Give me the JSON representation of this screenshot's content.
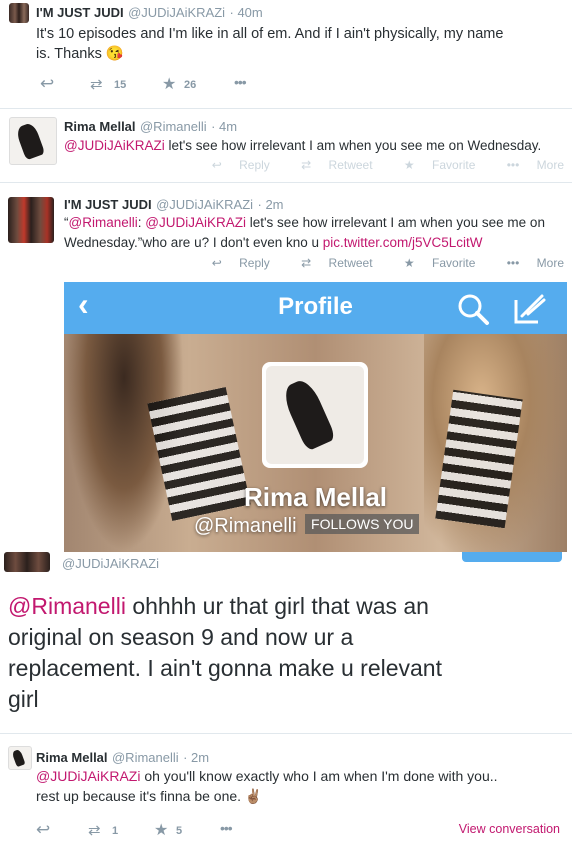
{
  "tweet1": {
    "name": "I'M JUST JUDI",
    "handle": "@JUDiJAiKRAZi",
    "time": "· 40m",
    "text_line1": "It's 10 episodes and I'm like in all of em. And if I ain't physically, my name",
    "text_line2": "is. Thanks",
    "emoji": "😘",
    "retweets": "15",
    "favorites": "26"
  },
  "tweet2": {
    "name": "Rima Mellal",
    "handle": "@Rimanelli",
    "time": "· 4m",
    "mention": "@JUDiJAiKRAZi",
    "text": " let's see how irrelevant I am when you see me on Wednesday.",
    "reply": "Reply",
    "retweet": "Retweet",
    "favorite": "Favorite",
    "more": "More"
  },
  "tweet3": {
    "name": "I'M JUST JUDI",
    "handle": "@JUDiJAiKRAZi",
    "time": "· 2m",
    "quote_open": "“",
    "mention1": "@Rimanelli",
    "colon": ": ",
    "mention2": "@JUDiJAiKRAZi",
    "text_line1_rest": " let's see how irrelevant I am when you see me on",
    "text_line2": "Wednesday.”who are u? I don't even kno u ",
    "pic_link": "pic.twitter.com/j5VC5LcitW",
    "reply": "Reply",
    "retweet": "Retweet",
    "favorite": "Favorite",
    "more": "More"
  },
  "profile_card": {
    "title": "Profile",
    "name": "Rima Mellal",
    "handle": "@Rimanelli",
    "follows": "FOLLOWS YOU",
    "header_color": "#55acee"
  },
  "big_tweet": {
    "handle": "@JUDiJAiKRAZi",
    "mention": "@Rimanelli",
    "line1_rest": " ohhhh ur that girl that was an",
    "line2": "original on season 9 and now ur a",
    "line3": "replacement. I ain't gonna make u relevant",
    "line4": "girl"
  },
  "tweet4": {
    "name": "Rima Mellal",
    "handle": "@Rimanelli",
    "time": "· 2m",
    "mention": "@JUDiJAiKRAZi",
    "text_line1_rest": " oh you'll know exactly who I am when I'm done with you..",
    "text_line2": "rest up because it's finna be one.",
    "emoji": "✌🏽",
    "retweets": "1",
    "favorites": "5",
    "view_conversation": "View conversation"
  },
  "colors": {
    "mention": "#c2186f",
    "muted": "#8899a6",
    "twitter_blue": "#55acee"
  }
}
